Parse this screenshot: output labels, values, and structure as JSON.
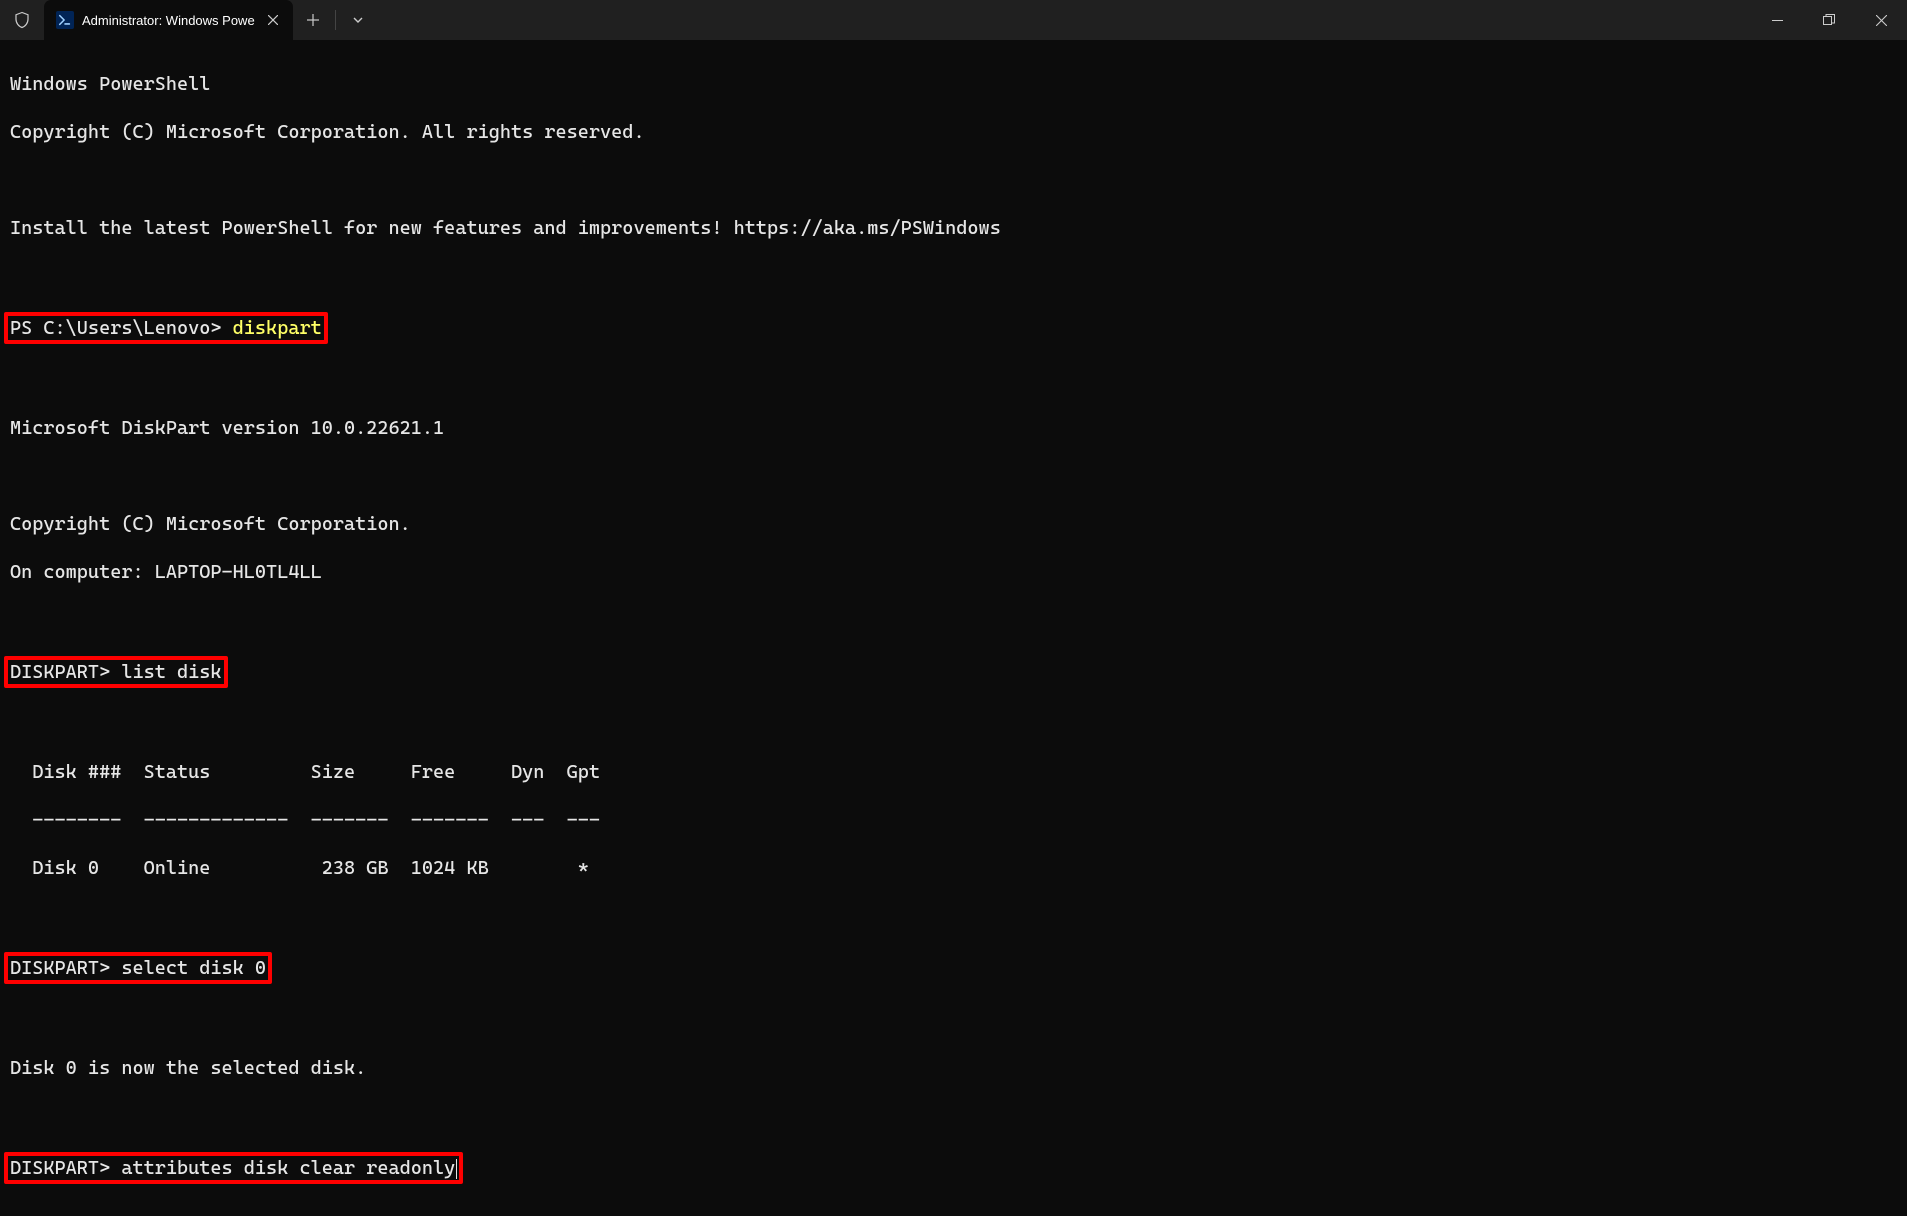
{
  "titlebar": {
    "tab_title": "Administrator: Windows Powe"
  },
  "terminal": {
    "banner_line1": "Windows PowerShell",
    "banner_line2": "Copyright (C) Microsoft Corporation. All rights reserved.",
    "banner_line3": "Install the latest PowerShell for new features and improvements! https://aka.ms/PSWindows",
    "ps_prompt": "PS C:\\Users\\Lenovo> ",
    "cmd_diskpart": "diskpart",
    "dp_version": "Microsoft DiskPart version 10.0.22621.1",
    "dp_copyright": "Copyright (C) Microsoft Corporation.",
    "dp_computer": "On computer: LAPTOP-HL0TL4LL",
    "dp_prompt": "DISKPART> ",
    "cmd_list": "list disk",
    "table_header": "  Disk ###  Status         Size     Free     Dyn  Gpt",
    "table_divider": "  --------  -------------  -------  -------  ---  ---",
    "table_row0": "  Disk 0    Online          238 GB  1024 KB        *",
    "cmd_select": "select disk 0",
    "select_result": "Disk 0 is now the selected disk.",
    "cmd_attr": "attributes disk clear readonly"
  }
}
